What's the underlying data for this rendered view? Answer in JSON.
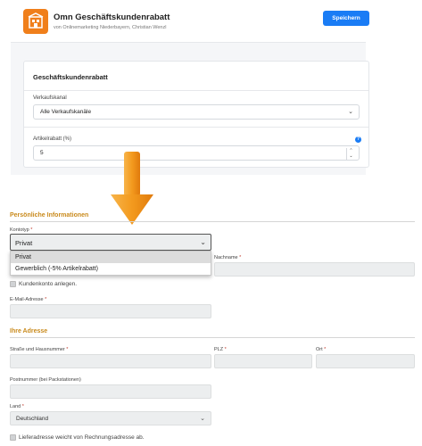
{
  "admin": {
    "app_title": "Omn Geschäftskundenrabatt",
    "app_subtitle": "von Onlinemarketing Niederbayern, Christian Wenzl",
    "save_label": "Speichern",
    "card_title": "Geschäftskundenrabatt",
    "sales_channel_label": "Verkaufskanal",
    "sales_channel_value": "Alle Verkaufskanäle",
    "discount_label": "Artikelrabatt (%)",
    "discount_value": "5",
    "help_icon_glyph": "?"
  },
  "arrow": {
    "color": "#f39a1e",
    "icon": "arrow-down-icon"
  },
  "form": {
    "personal_section_title": "Persönliche Informationen",
    "account_type_label": "Kontotyp",
    "account_type_value": "Privat",
    "account_type_options": [
      "Privat",
      "Gewerblich (-5% Artikelrabatt)"
    ],
    "last_name_label": "Nachname",
    "create_account_label": "Kundenkonto anlegen.",
    "email_label": "E-Mail-Adresse",
    "address_section_title": "Ihre Adresse",
    "street_label": "Straße und Hausnummer",
    "zip_label": "PLZ",
    "city_label": "Ort",
    "postnumber_label": "Postnummer (bei Packstationen)",
    "country_label": "Land",
    "country_value": "Deutschland",
    "different_shipping_label": "Lieferadresse weicht von Rechnungsadresse ab.",
    "required_marker": "*"
  },
  "colors": {
    "accent": "#1a7cf5",
    "section_title": "#c98a1c",
    "logo": "#f07f1b"
  }
}
